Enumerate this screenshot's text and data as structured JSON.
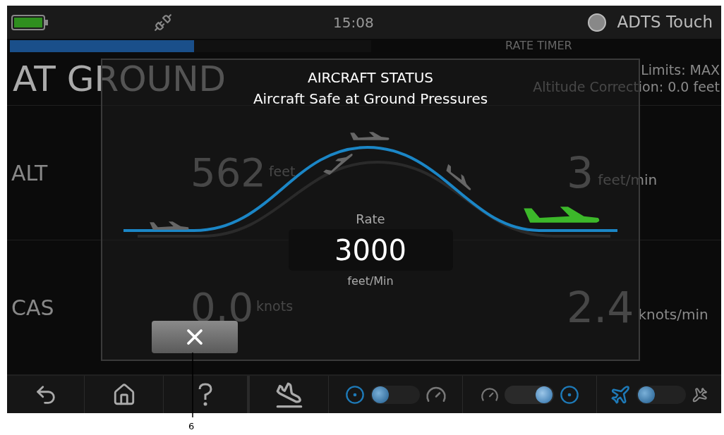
{
  "status_bar": {
    "time": "15:08",
    "product": "ADTS Touch"
  },
  "progress": {
    "level": 0.51
  },
  "background": {
    "mode": "AT GROUND",
    "timer_label": "RATE TIMER",
    "limits": "Limits: MAX",
    "correction": "Altitude Correction: 0.0 feet",
    "rows": [
      {
        "label": "ALT",
        "value": "562",
        "unit": "feet",
        "rate": "3",
        "rate_unit": "feet/min"
      },
      {
        "label": "CAS",
        "value": "0.0",
        "unit": "knots",
        "rate": "2.4",
        "rate_unit": "knots/min"
      }
    ]
  },
  "dialog": {
    "title": "AIRCRAFT STATUS",
    "message": "Aircraft Safe at Ground Pressures",
    "rate_label": "Rate",
    "rate_value": "3000",
    "rate_unit": "feet/Min"
  },
  "toggles": [
    {
      "on": false
    },
    {
      "on": true
    },
    {
      "on": false
    }
  ],
  "callout": {
    "label": "6"
  }
}
